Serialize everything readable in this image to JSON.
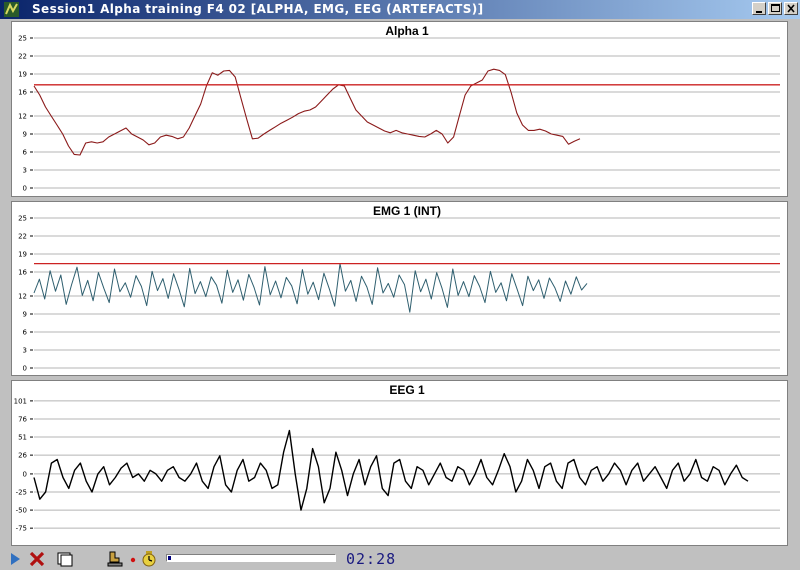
{
  "window": {
    "title": "Session1 Alpha training F4 02 [ALPHA, EMG, EEG (ARTEFACTS)]",
    "app_icon": "biofeedback-app-icon",
    "buttons": [
      "minimize-icon",
      "maximize-icon",
      "close-icon"
    ]
  },
  "colors": {
    "alpha_trace": "#8b1a1a",
    "threshold": "#cc2222",
    "emg_trace": "#2f5f6f",
    "eeg_trace": "#000000",
    "grid": "#b4b4b4"
  },
  "chart_data": [
    {
      "type": "line",
      "title": "Alpha 1",
      "yticks": [
        0,
        3,
        6,
        9,
        12,
        16,
        19,
        22,
        25
      ],
      "ylim": [
        0,
        25
      ],
      "threshold": 17.2,
      "series": [
        {
          "values": [
            17,
            15.5,
            13.5,
            12,
            10.5,
            9,
            7,
            5.6,
            5.5,
            7.5,
            7.7,
            7.5,
            7.7,
            8.5,
            9,
            9.5,
            10,
            9,
            8.5,
            8,
            7.2,
            7.5,
            8.5,
            8.8,
            8.6,
            8.2,
            8.5,
            10,
            12,
            14,
            17,
            19.2,
            18.8,
            19.5,
            19.6,
            18.5,
            15,
            11.5,
            8.2,
            8.3,
            9,
            9.6,
            10.2,
            10.8,
            11.3,
            11.8,
            12.4,
            12.8,
            13,
            13.5,
            14.5,
            15.5,
            16.5,
            17.2,
            17,
            15,
            13,
            12,
            11,
            10.5,
            10,
            9.5,
            9.2,
            9.6,
            9.2,
            9,
            8.8,
            8.6,
            8.5,
            9,
            9.6,
            9,
            7.5,
            8.5,
            12,
            15.5,
            17,
            17.5,
            18,
            19.5,
            19.8,
            19.6,
            18.9,
            16,
            12.5,
            10.5,
            9.6,
            9.6,
            9.8,
            9.5,
            9,
            8.8,
            8.6,
            7.3,
            7.8,
            8.2
          ]
        }
      ]
    },
    {
      "type": "line",
      "title": "EMG 1 (INT)",
      "yticks": [
        0,
        3,
        6,
        9,
        12,
        16,
        19,
        22,
        25
      ],
      "ylim": [
        0,
        25
      ],
      "threshold": 17.4,
      "series": [
        {
          "values": [
            12.5,
            14.8,
            11.5,
            16.2,
            12.8,
            15.5,
            10.6,
            13.9,
            16.8,
            12.1,
            14.6,
            11.2,
            15.9,
            13.3,
            10.9,
            16.5,
            12.7,
            14.2,
            11.8,
            15.4,
            13.6,
            10.4,
            16.1,
            12.9,
            14.9,
            11.6,
            15.7,
            13.1,
            10.2,
            16.6,
            12.4,
            14.4,
            11.9,
            15.2,
            13.8,
            10.8,
            16.3,
            12.6,
            14.7,
            11.3,
            15.6,
            13.4,
            10.5,
            16.9,
            12.2,
            14.5,
            11.7,
            15.1,
            13.7,
            10.7,
            16.4,
            12.3,
            14.3,
            11.4,
            15.8,
            13.2,
            10.3,
            17.4,
            12.8,
            14.6,
            11.1,
            15.3,
            13.5,
            10.6,
            16.7,
            12.5,
            14.1,
            11.8,
            15.5,
            13.9,
            9.3,
            16.2,
            12.7,
            14.8,
            11.5,
            15.9,
            13.3,
            10.1,
            16.5,
            12.1,
            14.4,
            11.9,
            15.4,
            13.6,
            10.9,
            16.1,
            12.6,
            14.2,
            11.2,
            15.7,
            13.1,
            10.4,
            15.3,
            12.9,
            14.7,
            11.6,
            15.0,
            13.4,
            11.1,
            14.5,
            12.3,
            15.2,
            13.0,
            14.1
          ]
        }
      ]
    },
    {
      "type": "line",
      "title": "EEG 1",
      "yticks": [
        -75,
        -50,
        -25,
        0,
        26,
        51,
        76,
        101
      ],
      "ylim": [
        -90,
        105
      ],
      "series": [
        {
          "values": [
            -5,
            -35,
            -25,
            15,
            20,
            -5,
            -20,
            5,
            15,
            -10,
            -25,
            0,
            10,
            -15,
            -5,
            8,
            15,
            -5,
            0,
            -10,
            5,
            0,
            -10,
            5,
            10,
            -5,
            -10,
            0,
            15,
            -10,
            -20,
            10,
            25,
            -15,
            -25,
            5,
            20,
            -10,
            -5,
            15,
            5,
            -20,
            -15,
            30,
            60,
            0,
            -50,
            -20,
            35,
            10,
            -40,
            -20,
            30,
            5,
            -30,
            0,
            20,
            -15,
            10,
            25,
            -20,
            -30,
            15,
            20,
            -10,
            -20,
            10,
            5,
            -15,
            0,
            15,
            -5,
            -10,
            10,
            5,
            -15,
            0,
            20,
            -5,
            -15,
            5,
            28,
            10,
            -25,
            -10,
            20,
            5,
            -20,
            10,
            15,
            -10,
            -20,
            15,
            20,
            -5,
            -15,
            5,
            10,
            -10,
            0,
            15,
            5,
            -15,
            5,
            15,
            -10,
            0,
            10,
            -5,
            -20,
            5,
            15,
            -10,
            0,
            20,
            -5,
            -10,
            10,
            5,
            -15,
            0,
            12,
            -5,
            -10
          ]
        }
      ]
    }
  ],
  "toolbar": {
    "icons": [
      "play-icon",
      "stop-icon",
      "new-window-icon",
      "patient-icon",
      "record-indicator-icon",
      "timer-icon"
    ],
    "progress_fraction": 0.01,
    "timer": "02:28"
  }
}
